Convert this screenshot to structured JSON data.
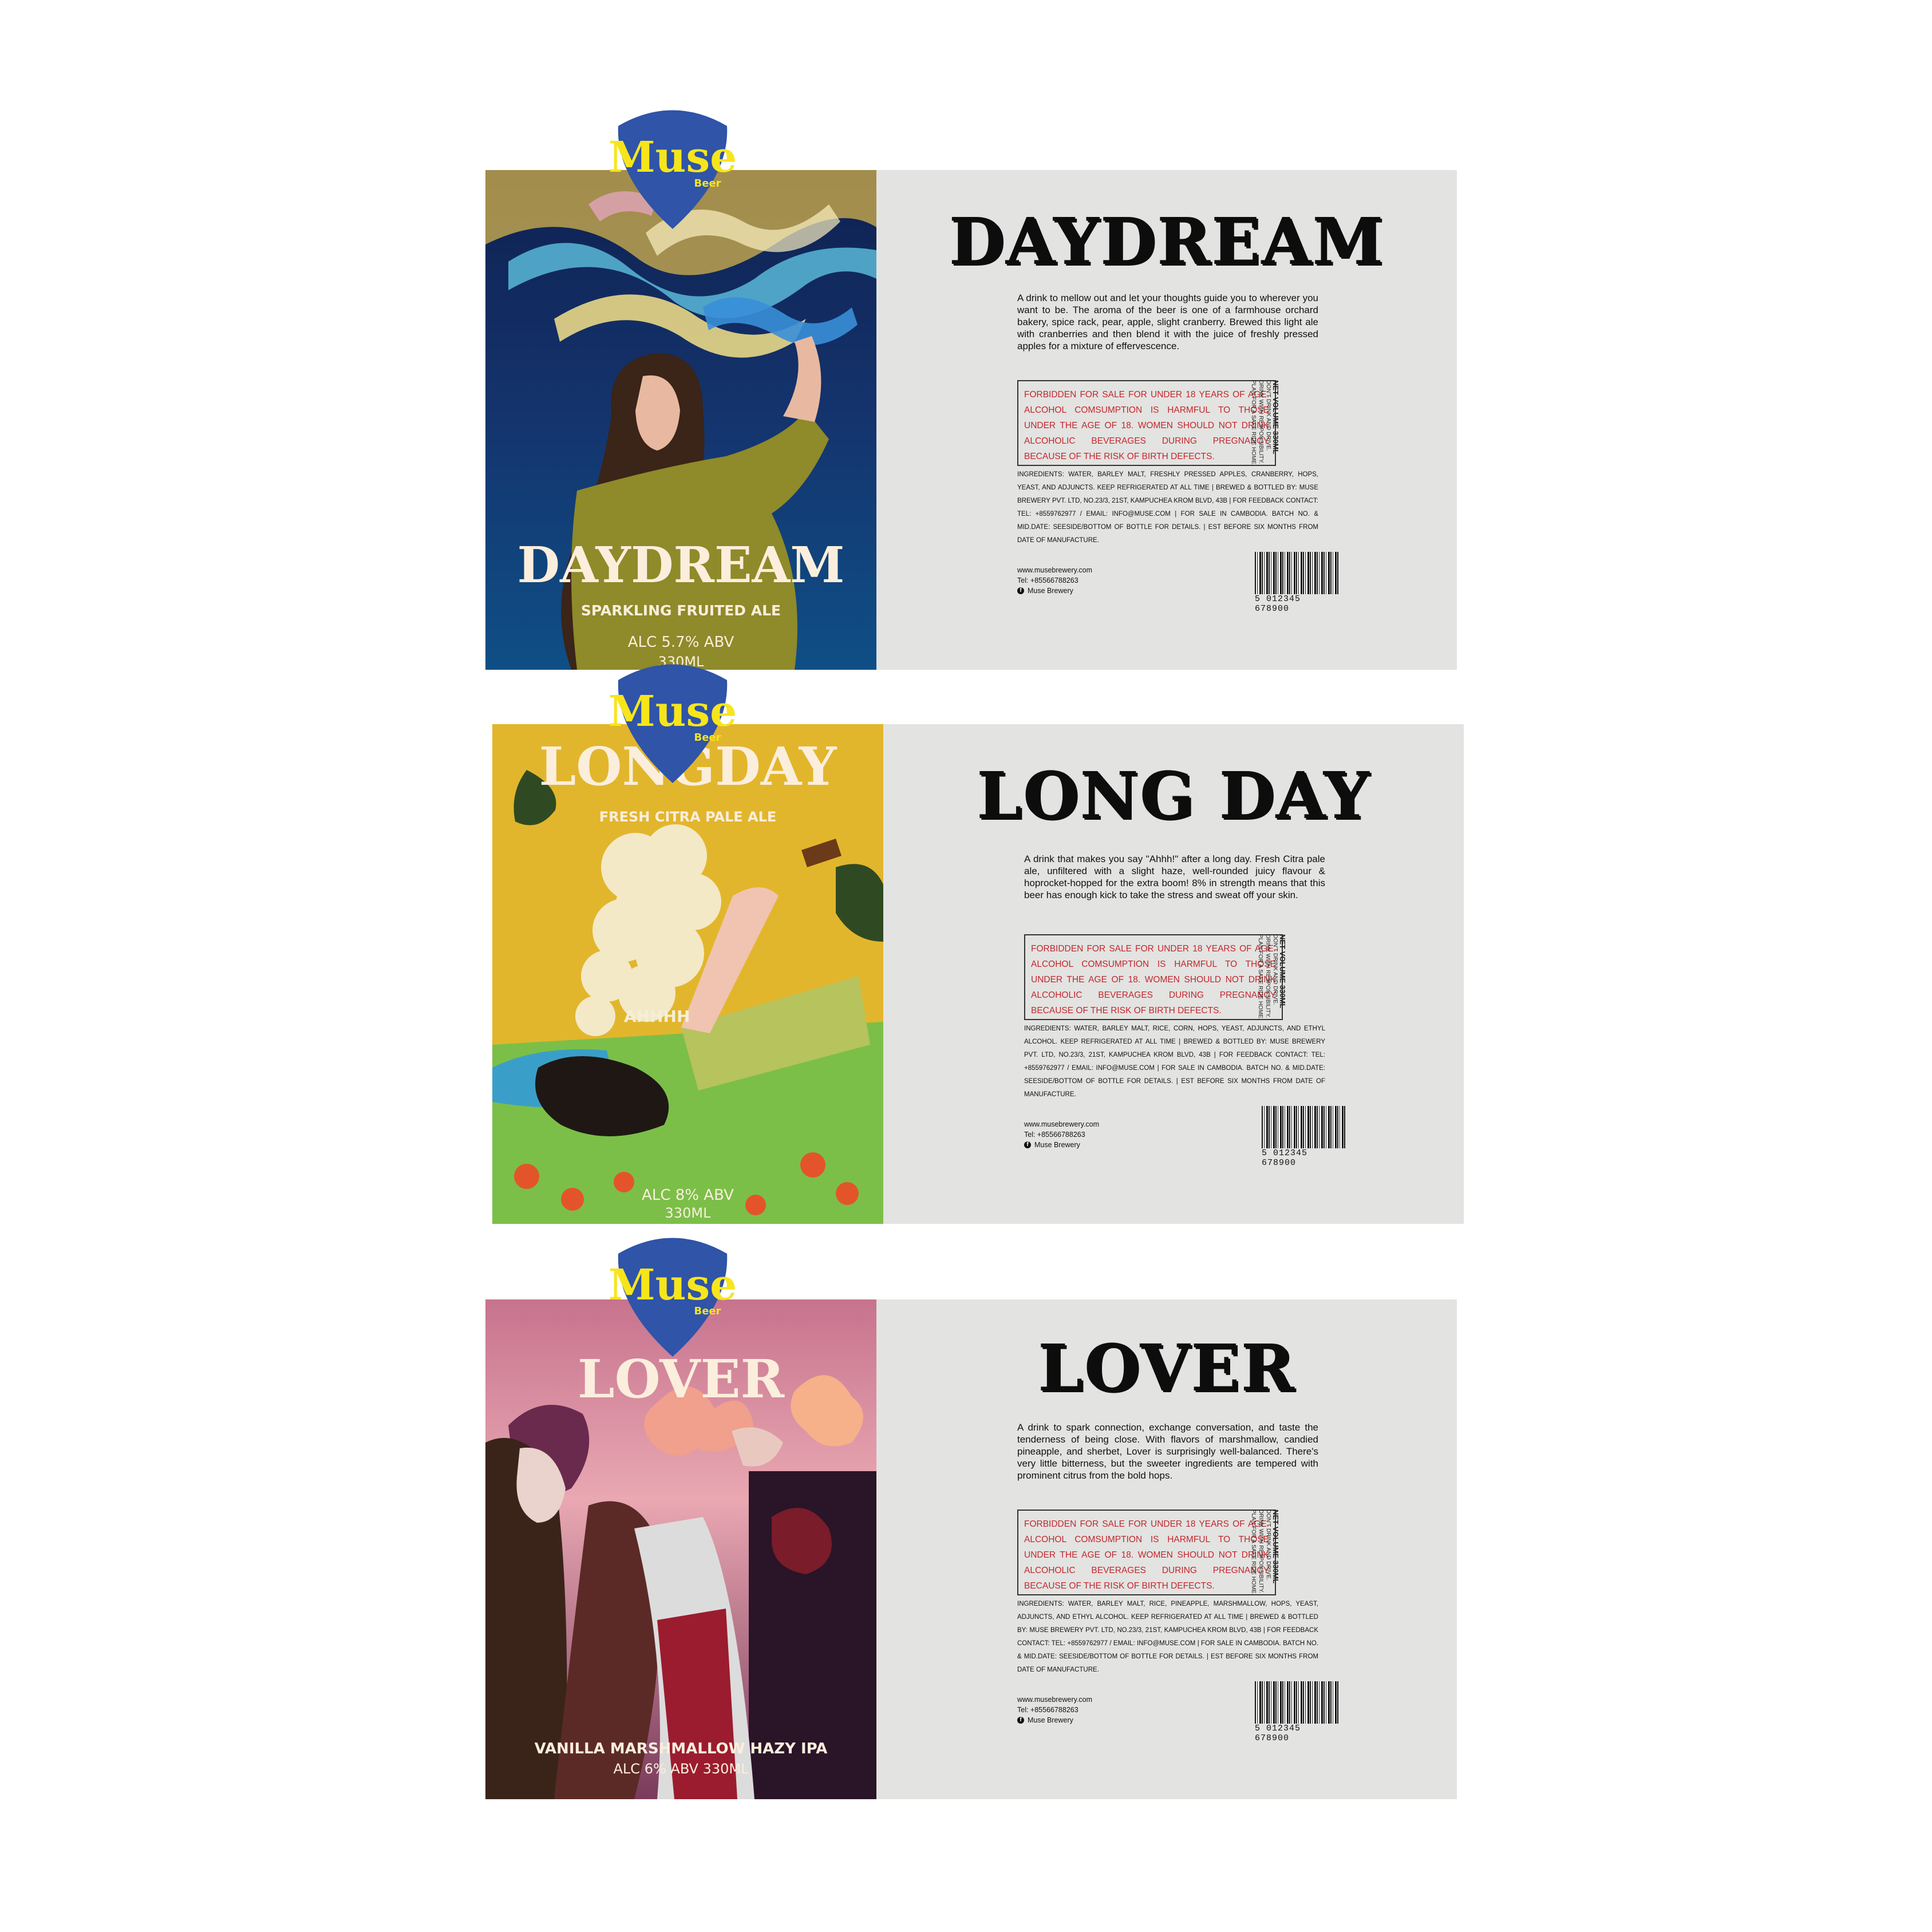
{
  "logo": {
    "name": "Muse",
    "sub": "Beer",
    "color": "#2f54a8",
    "text_color": "#f7e51c"
  },
  "common": {
    "warning": "FORBIDDEN FOR SALE FOR UNDER 18 YEARS OF AGE. ALCOHOL COMSUMPTION IS HARMFUL TO THOSE UNDER THE AGE OF 18. WOMEN SHOULD NOT DRINK ALCOHOLIC BEVERAGES DURING PREGNANCY BECAUSE OF THE RISK OF BIRTH DEFECTS.",
    "side_note": "DON'T DRINK AND DRIVE. DRINK WITH RESPONSIBILITY. PLAN FOR A SAFE RIDE HOME.",
    "net_volume": "NET VOLUME 330ML",
    "website": "www.musebrewery.com",
    "tel": "Tel: +85566788263",
    "facebook": "Muse Brewery",
    "barcode": "5 012345 678900"
  },
  "labels": [
    {
      "front_title": "DAYDREAM",
      "front_subtitle": "SPARKLING FRUITED ALE",
      "front_abv": "ALC 5.7% ABV",
      "front_volume": "330ML",
      "back_title": "DAYDREAM",
      "description": "A drink to mellow out and let your thoughts guide you to wherever you want to be. The aroma of the beer is one of a farmhouse orchard bakery, spice rack, pear, apple, slight cranberry. Brewed this light ale with cranberries and then blend it with the juice of freshly pressed apples for a mixture of effervescence.",
      "ingredients": "INGREDIENTS: WATER, BARLEY MALT, FRESHLY PRESSED APPLES, CRANBERRY, HOPS, YEAST, AND ADJUNCTS. KEEP REFRIGERATED AT ALL TIME | BREWED & BOTTLED BY: MUSE BREWERY PVT. LTD, NO.23/3, 21ST, KAMPUCHEA KROM BLVD, 43B | FOR FEEDBACK CONTACT: TEL: +8559762977 / EMAIL: INFO@MUSE.COM | FOR SALE IN CAMBODIA. BATCH NO. & MID.DATE: SEESIDE/BOTTOM OF BOTTLE FOR DETAILS. | EST BEFORE SIX MONTHS FROM DATE OF MANUFACTURE."
    },
    {
      "front_title": "LONGDAY",
      "front_subtitle": "FRESH CITRA PALE ALE",
      "front_abv": "ALC 8% ABV",
      "front_volume": "330ML",
      "bubble_text": "AHHHH",
      "back_title": "LONG DAY",
      "description": "A drink that makes you say \"Ahhh!\" after a long day. Fresh Citra pale ale, unfiltered with a slight haze, well-rounded juicy flavour & hoprocket-hopped for the extra boom! 8% in strength means that this beer has enough kick to take the stress and sweat off your skin.",
      "ingredients": "INGREDIENTS: WATER, BARLEY MALT, RICE, CORN, HOPS, YEAST, ADJUNCTS, AND ETHYL ALCOHOL. KEEP REFRIGERATED AT ALL TIME | BREWED & BOTTLED BY: MUSE BREWERY PVT. LTD, NO.23/3, 21ST, KAMPUCHEA KROM BLVD, 43B | FOR FEEDBACK CONTACT: TEL: +8559762977 / EMAIL: INFO@MUSE.COM | FOR SALE IN CAMBODIA. BATCH NO. & MID.DATE: SEESIDE/BOTTOM OF BOTTLE FOR DETAILS. | EST BEFORE SIX MONTHS FROM DATE OF MANUFACTURE."
    },
    {
      "front_title": "LOVER",
      "front_subtitle": "VANILLA MARSHMALLOW HAZY IPA",
      "front_abv": "ALC 6% ABV 330ML",
      "back_title": "LOVER",
      "description": "A drink to spark connection, exchange conversation, and taste the tenderness of being close. With flavors of marshmallow, candied pineapple, and sherbet, Lover is surprisingly well-balanced. There's very little bitterness, but the sweeter ingredients are tempered with prominent citrus from the bold hops.",
      "ingredients": "INGREDIENTS: WATER, BARLEY MALT, RICE, PINEAPPLE, MARSHMALLOW, HOPS, YEAST, ADJUNCTS, AND ETHYL ALCOHOL. KEEP REFRIGERATED AT ALL TIME | BREWED & BOTTLED BY: MUSE BREWERY PVT. LTD, NO.23/3, 21ST, KAMPUCHEA KROM BLVD, 43B | FOR FEEDBACK CONTACT: TEL: +8559762977 / EMAIL: INFO@MUSE.COM | FOR SALE IN CAMBODIA. BATCH NO. & MID.DATE: SEESIDE/BOTTOM OF BOTTLE FOR DETAILS. | EST BEFORE SIX MONTHS FROM DATE OF MANUFACTURE."
    }
  ]
}
